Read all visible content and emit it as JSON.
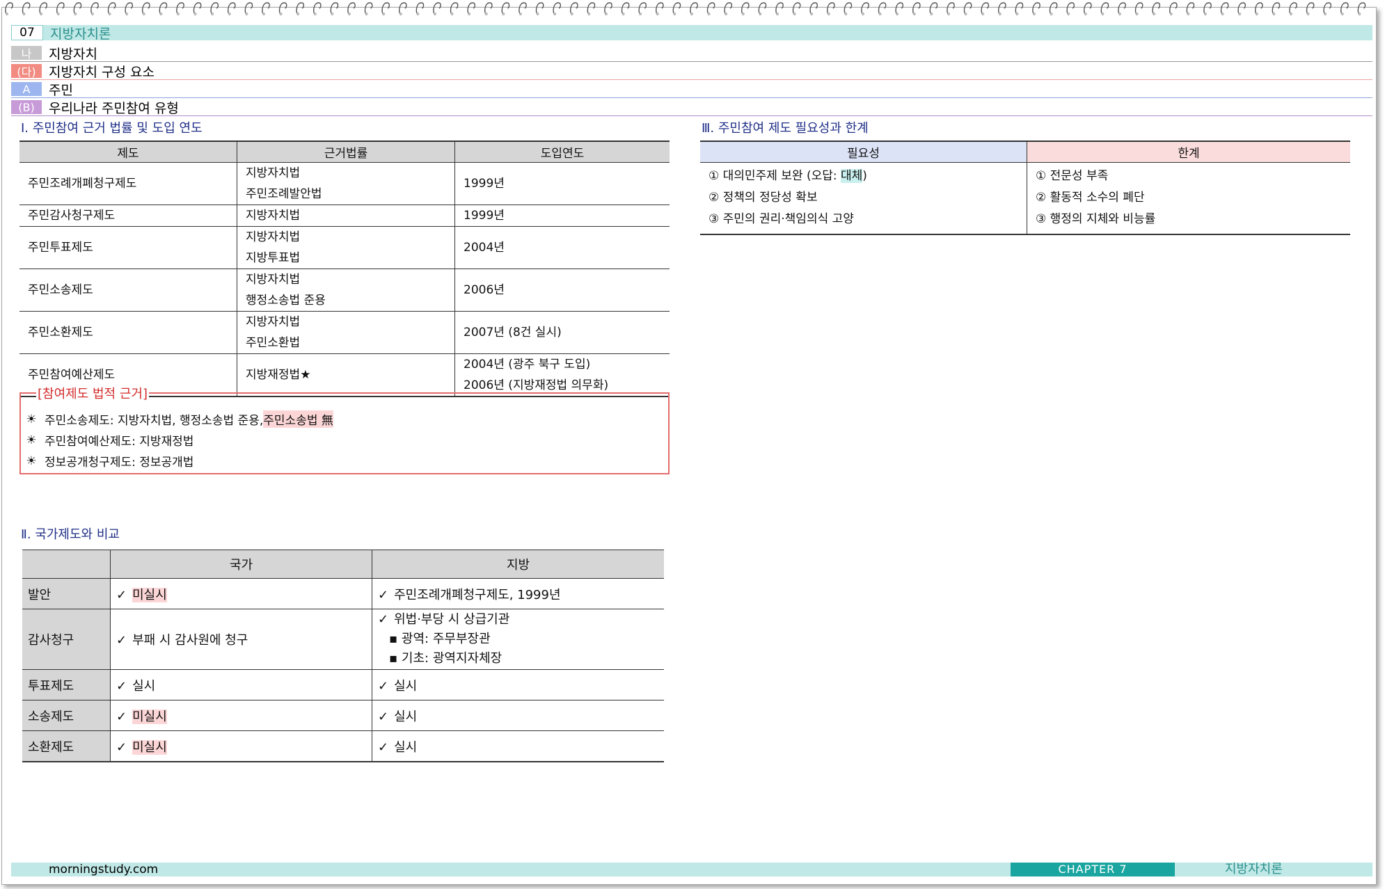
{
  "header": {
    "chapter_num": "07",
    "chapter_title": "지방자치론",
    "rows": [
      {
        "tag": "나",
        "tag_color": "#c7c7c7",
        "text": "지방자치"
      },
      {
        "tag": "(다)",
        "tag_color": "#f28b82",
        "text": "지방자치 구성 요소"
      },
      {
        "tag": "A",
        "tag_color": "#9db6ef",
        "text": "주민"
      },
      {
        "tag": "(B)",
        "tag_color": "#c79ad8",
        "text": "우리나라 주민참여 유형"
      }
    ]
  },
  "section1": {
    "heading": "Ⅰ. 주민참여 근거 법률 및 도입 연도",
    "columns": [
      "제도",
      "근거법률",
      "도입연도"
    ],
    "rows": [
      {
        "name": "주민조례개폐청구제도",
        "law1": "지방자치법",
        "law2": "주민조례발안법",
        "year1": "1999년",
        "year2": ""
      },
      {
        "name": "주민감사청구제도",
        "law1": "지방자치법",
        "law2": "",
        "year1": "1999년",
        "year2": ""
      },
      {
        "name": "주민투표제도",
        "law1": "지방자치법",
        "law2": "지방투표법",
        "year1": "2004년",
        "year2": ""
      },
      {
        "name": "주민소송제도",
        "law1": "지방자치법",
        "law2": "행정소송법 준용",
        "year1": "2006년",
        "year2": ""
      },
      {
        "name": "주민소환제도",
        "law1": "지방자치법",
        "law2": "주민소환법",
        "year1": "2007년 (8건 실시)",
        "year2": ""
      },
      {
        "name": "주민참여예산제도",
        "law1": "지방재정법★",
        "law2": "",
        "year1": "2004년 (광주 북구 도입)",
        "year2": "2006년 (지방재정법 의무화)"
      }
    ]
  },
  "legal_box": {
    "title": "[참여제도 법적 근거]",
    "items": [
      {
        "text": "주민소송제도: 지방자치법, 행정소송법 준용, ",
        "highlight": "주민소송법 無"
      },
      {
        "text": "주민참여예산제도: 지방재정법",
        "highlight": ""
      },
      {
        "text": "정보공개청구제도: 정보공개법",
        "highlight": ""
      }
    ]
  },
  "section2": {
    "heading": "Ⅱ. 국가제도와 비교",
    "columns": [
      "",
      "국가",
      "지방"
    ],
    "rows": [
      {
        "label": "발안",
        "national": "미실시",
        "national_hl": true,
        "local": "주민조례개폐청구제도, 1999년",
        "local_sub": []
      },
      {
        "label": "감사청구",
        "national": "부패 시 감사원에 청구",
        "national_hl": false,
        "local": "위법·부당 시 상급기관",
        "local_sub": [
          "광역: 주무부장관",
          "기초: 광역지자체장"
        ]
      },
      {
        "label": "투표제도",
        "national": "실시",
        "national_hl": false,
        "local": "실시",
        "local_sub": []
      },
      {
        "label": "소송제도",
        "national": "미실시",
        "national_hl": true,
        "local": "실시",
        "local_sub": []
      },
      {
        "label": "소환제도",
        "national": "미실시",
        "national_hl": true,
        "local": "실시",
        "local_sub": []
      }
    ]
  },
  "section3": {
    "heading": "Ⅲ. 주민참여 제도 필요성과 한계",
    "need_header": "필요성",
    "limit_header": "한계",
    "needs": [
      {
        "mark": "①",
        "text": "대의민주제 보완 (오답: ",
        "highlight": "대체",
        "tail": ")"
      },
      {
        "mark": "②",
        "text": "정책의 정당성 확보",
        "highlight": "",
        "tail": ""
      },
      {
        "mark": "③",
        "text": "주민의 권리·책임의식 고양",
        "highlight": "",
        "tail": ""
      }
    ],
    "limits": [
      {
        "mark": "①",
        "text": "전문성 부족"
      },
      {
        "mark": "②",
        "text": "활동적 소수의 폐단"
      },
      {
        "mark": "③",
        "text": "행정의 지체와 비능률"
      }
    ]
  },
  "footer": {
    "site": "morningstudy.com",
    "chapter": "CHAPTER 7",
    "title": "지방자치론"
  },
  "colors": {
    "accent_teal": "#1aa5a0",
    "header_band": "#bfe8e6",
    "highlight_pink": "#fcd6d6",
    "legal_box_border": "#e46a6a"
  },
  "icons": {
    "bullet": "sun-icon",
    "check": "checkmark-icon"
  }
}
